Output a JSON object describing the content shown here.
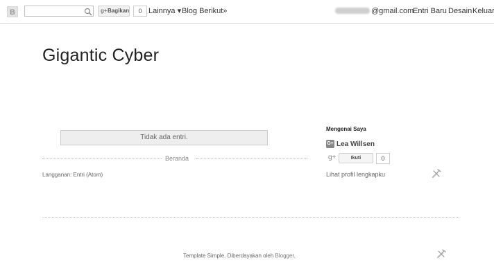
{
  "navbar": {
    "search_placeholder": "",
    "share_label": "Bagikan",
    "share_count": "0",
    "more_label": "Lainnya ▾",
    "next_blog_label": "Blog Berikut»",
    "email_suffix": "@gmail.com",
    "new_post_label": "Entri Baru",
    "design_label": "Desain",
    "logout_label": "Keluar",
    "logo_icon": "blogger-logo-icon",
    "search_icon": "search-icon"
  },
  "blog": {
    "title": "Gigantic Cyber"
  },
  "main": {
    "no_posts_text": "Tidak ada entri.",
    "home_link": "Beranda",
    "subscribe_prefix": "Langganan: ",
    "subscribe_link": "Entri (Atom)"
  },
  "sidebar": {
    "widget_title": "Mengenai Saya",
    "profile_badge": "G+",
    "profile_name": "Lea Willsen",
    "follow_icon": "g+",
    "follow_label": "Ikuti",
    "follow_count": "0",
    "profile_link": "Lihat profil lengkapku"
  },
  "footer": {
    "text": "Template Simple. Diberdayakan oleh ",
    "link": "Blogger",
    "suffix": "."
  },
  "colors": {
    "text": "#333333",
    "box_bg": "#eeeeee",
    "link": "#666666"
  }
}
